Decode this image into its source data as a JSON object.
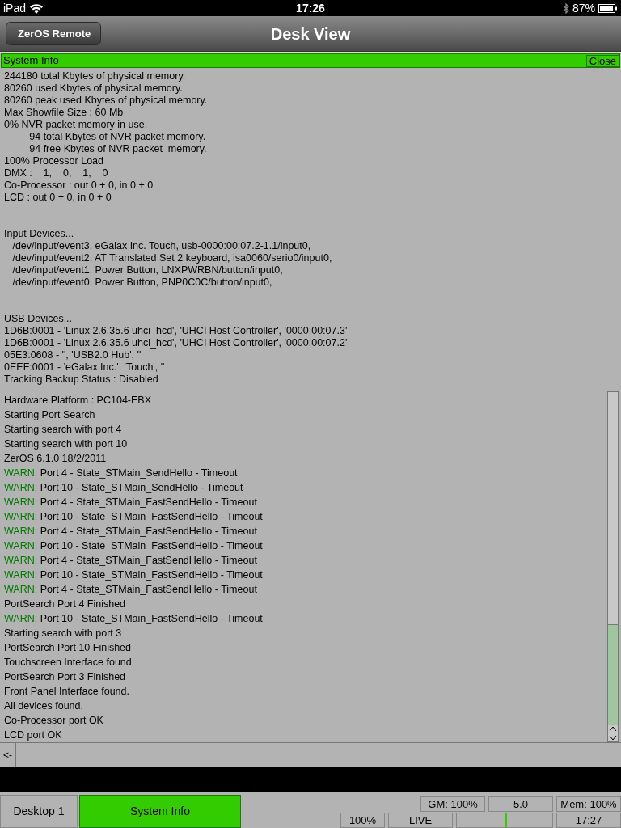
{
  "status_bar": {
    "device": "iPad",
    "time": "17:26",
    "battery": "87%"
  },
  "nav_bar": {
    "back": "ZerOS Remote",
    "title": "Desk View"
  },
  "panel": {
    "title": "System Info",
    "close": "Close"
  },
  "info_sections": [
    [
      "244180 total Kbytes of physical memory.",
      "80260 used Kbytes of physical memory.",
      "80260 peak used Kbytes of physical memory.",
      "Max Showfile Size : 60 Mb",
      "0% NVR packet memory in use.",
      "         94 total Kbytes of NVR packet memory.",
      "         94 free Kbytes of NVR packet  memory.",
      "100% Processor Load",
      "DMX :    1,    0,    1,    0",
      "Co-Processor : out 0 + 0, in 0 + 0",
      "LCD : out 0 + 0, in 0 + 0"
    ],
    [
      "Input Devices...",
      "   /dev/input/event3, eGalax Inc. Touch, usb-0000:00:07.2-1.1/input0,",
      "   /dev/input/event2, AT Translated Set 2 keyboard, isa0060/serio0/input0,",
      "   /dev/input/event1, Power Button, LNXPWRBN/button/input0,",
      "   /dev/input/event0, Power Button, PNP0C0C/button/input0,"
    ],
    [
      "USB Devices...",
      "1D6B:0001 - 'Linux 2.6.35.6 uhci_hcd', 'UHCI Host Controller', '0000:00:07.3'",
      "1D6B:0001 - 'Linux 2.6.35.6 uhci_hcd', 'UHCI Host Controller', '0000:00:07.2'",
      "05E3:0608 - '', 'USB2.0 Hub', ''",
      "0EEF:0001 - 'eGalax Inc.', 'Touch', ''",
      "Tracking Backup Status : Disabled"
    ]
  ],
  "log": [
    {
      "kind": "plain",
      "text": "Hardware Platform : PC104-EBX"
    },
    {
      "kind": "plain",
      "text": "Starting Port Search"
    },
    {
      "kind": "plain",
      "text": "Starting search with port 4"
    },
    {
      "kind": "plain",
      "text": "Starting search with port 10"
    },
    {
      "kind": "plain",
      "text": "ZerOS 6.1.0 18/2/2011"
    },
    {
      "kind": "warn",
      "prefix": "WARN:",
      "text": "Port 4 - State_STMain_SendHello - Timeout"
    },
    {
      "kind": "warn",
      "prefix": "WARN:",
      "text": "Port 10 - State_STMain_SendHello - Timeout"
    },
    {
      "kind": "warn",
      "prefix": "WARN:",
      "text": "Port 4 - State_STMain_FastSendHello - Timeout"
    },
    {
      "kind": "warn",
      "prefix": "WARN:",
      "text": "Port 10 - State_STMain_FastSendHello - Timeout"
    },
    {
      "kind": "warn",
      "prefix": "WARN:",
      "text": "Port 4 - State_STMain_FastSendHello - Timeout"
    },
    {
      "kind": "warn",
      "prefix": "WARN:",
      "text": "Port 10 - State_STMain_FastSendHello - Timeout"
    },
    {
      "kind": "warn",
      "prefix": "WARN:",
      "text": "Port 4 - State_STMain_FastSendHello - Timeout"
    },
    {
      "kind": "warn",
      "prefix": "WARN:",
      "text": "Port 10 - State_STMain_FastSendHello - Timeout"
    },
    {
      "kind": "warn",
      "prefix": "WARN:",
      "text": "Port 4 - State_STMain_FastSendHello - Timeout"
    },
    {
      "kind": "plain",
      "text": "PortSearch Port 4 Finished"
    },
    {
      "kind": "warn",
      "prefix": "WARN:",
      "text": "Port 10 - State_STMain_FastSendHello - Timeout"
    },
    {
      "kind": "plain",
      "text": "Starting search with port 3"
    },
    {
      "kind": "plain",
      "text": "PortSearch Port 10 Finished"
    },
    {
      "kind": "plain",
      "text": "Touchscreen Interface found."
    },
    {
      "kind": "plain",
      "text": "PortSearch Port 3 Finished"
    },
    {
      "kind": "plain",
      "text": "Front Panel Interface found."
    },
    {
      "kind": "plain",
      "text": "All devices found."
    },
    {
      "kind": "plain",
      "text": "Co-Processor port OK"
    },
    {
      "kind": "plain",
      "text": "LCD port OK"
    }
  ],
  "command_line": {
    "back": "<-"
  },
  "tabs": [
    {
      "label": "Desktop 1",
      "selected": false
    },
    {
      "label": "System Info",
      "selected": true
    }
  ],
  "status_cells": {
    "gm": "GM: 100%",
    "rate": "5.0",
    "mem": "Mem: 100%",
    "percent": "100%",
    "mode": "LIVE",
    "meter": {
      "level": 0.5
    },
    "clock": "17:27"
  }
}
